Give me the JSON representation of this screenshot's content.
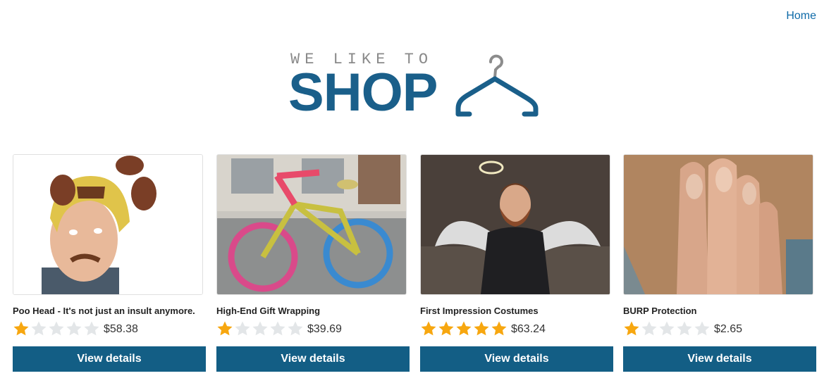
{
  "nav": {
    "home_label": "Home"
  },
  "logo": {
    "line1": "WE LIKE TO",
    "line2": "SHOP",
    "icon": "hanger-icon",
    "color": "#1a5f8a"
  },
  "colors": {
    "button": "#135e85",
    "star_on": "#f7a710",
    "star_off": "#e3e6e8",
    "link": "#0e6aa8"
  },
  "products": [
    {
      "title": "Poo Head - It's not just an insult anymore.",
      "rating": 1,
      "max_rating": 5,
      "price": "$58.38",
      "button": "View details",
      "image": "man-with-brown-bear-hat"
    },
    {
      "title": "High-End Gift Wrapping",
      "rating": 1,
      "max_rating": 5,
      "price": "$39.69",
      "button": "View details",
      "image": "yarn-bombed-bicycle"
    },
    {
      "title": "First Impression Costumes",
      "rating": 5,
      "max_rating": 5,
      "price": "$63.24",
      "button": "View details",
      "image": "bearded-man-with-angel-wings"
    },
    {
      "title": "BURP Protection",
      "rating": 1,
      "max_rating": 5,
      "price": "$2.65",
      "button": "View details",
      "image": "hand-covering-bearded-mouth"
    }
  ]
}
